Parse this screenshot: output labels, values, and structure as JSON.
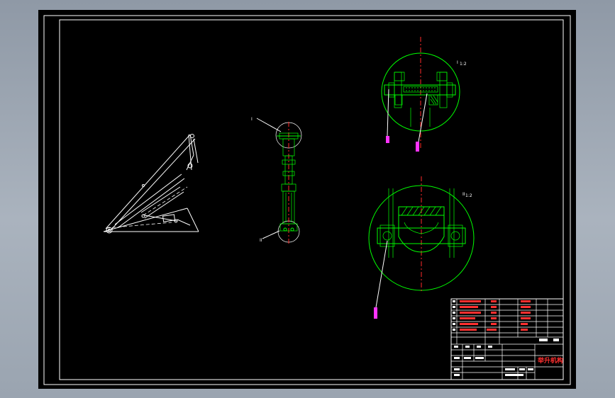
{
  "callouts": {
    "a": "I",
    "b": "II"
  },
  "detail_views": {
    "detail_1": "I",
    "detail_2": "II",
    "scale_1": "1:2",
    "scale_2": "1:2"
  },
  "title_block": {
    "title": "举升机构"
  },
  "colors": {
    "background": "#000000",
    "outline": "#ffffff",
    "detail": "#00ff00",
    "centerline": "#ff2a2a",
    "annotation": "#ff33ff",
    "frame": "#aab3be"
  }
}
